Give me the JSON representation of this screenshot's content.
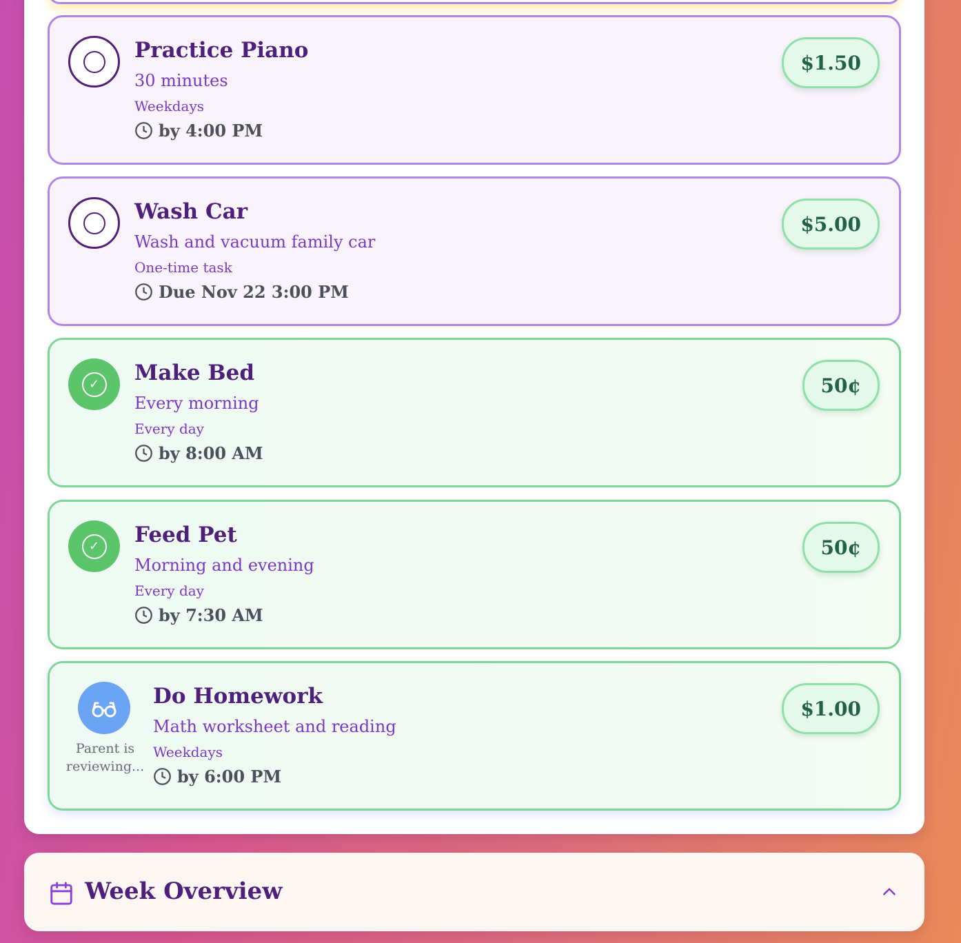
{
  "chores": [
    {
      "title": "Practice Piano",
      "description": "30 minutes",
      "frequency": "Weekdays",
      "due": "by 4:00 PM",
      "reward": "$1.50",
      "state": "pending"
    },
    {
      "title": "Wash Car",
      "description": "Wash and vacuum family car",
      "frequency": "One-time task",
      "due": "Due Nov 22 3:00 PM",
      "reward": "$5.00",
      "state": "pending"
    },
    {
      "title": "Make Bed",
      "description": "Every morning",
      "frequency": "Every day",
      "due": "by 8:00 AM",
      "reward": "50¢",
      "state": "completed"
    },
    {
      "title": "Feed Pet",
      "description": "Morning and evening",
      "frequency": "Every day",
      "due": "by 7:30 AM",
      "reward": "50¢",
      "state": "completed"
    },
    {
      "title": "Do Homework",
      "description": "Math worksheet and reading",
      "frequency": "Weekdays",
      "due": "by 6:00 PM",
      "reward": "$1.00",
      "state": "reviewing",
      "status_text": "Parent is reviewing..."
    }
  ],
  "week_overview": {
    "title": "Week Overview"
  },
  "icons": {
    "pending": "empty-circle-icon",
    "completed": "check-circle-icon",
    "reviewing": "glasses-icon",
    "due": "clock-icon",
    "week": "calendar-icon",
    "collapse": "chevron-up-icon"
  },
  "colors": {
    "pending_border": "#b184ec",
    "completed_border": "#7ed895",
    "completed_icon": "#5cc56b",
    "reviewing_icon": "#6aa4f3",
    "title": "#4f1f7c",
    "accent": "#7b37c8",
    "reward_text": "#206148"
  }
}
